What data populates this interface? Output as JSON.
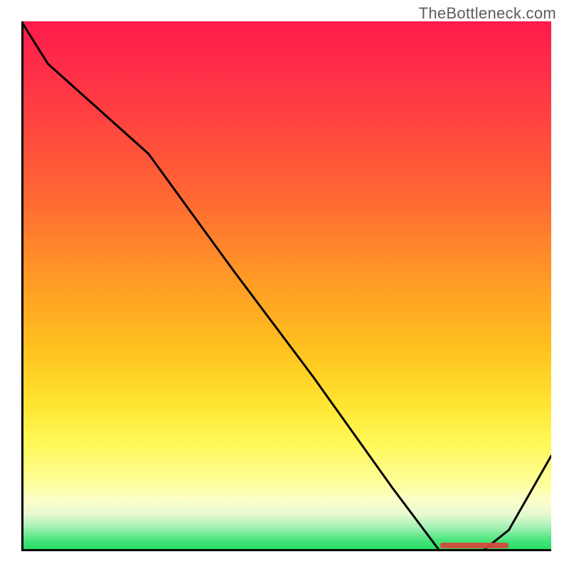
{
  "watermark": "TheBottleneck.com",
  "chart_data": {
    "type": "line",
    "title": "",
    "xlabel": "",
    "ylabel": "",
    "xlim": [
      0,
      100
    ],
    "ylim": [
      0,
      100
    ],
    "x": [
      0,
      5,
      24,
      40,
      55,
      70,
      79,
      82,
      87,
      92,
      100
    ],
    "values": [
      100,
      92,
      75,
      53,
      33,
      12,
      0,
      0,
      0,
      4,
      18
    ],
    "optimal_range_x": [
      79,
      92
    ],
    "background_gradient": {
      "top": "#ff1a4a",
      "mid": "#ffc21e",
      "bottom": "#1fdb62"
    }
  }
}
